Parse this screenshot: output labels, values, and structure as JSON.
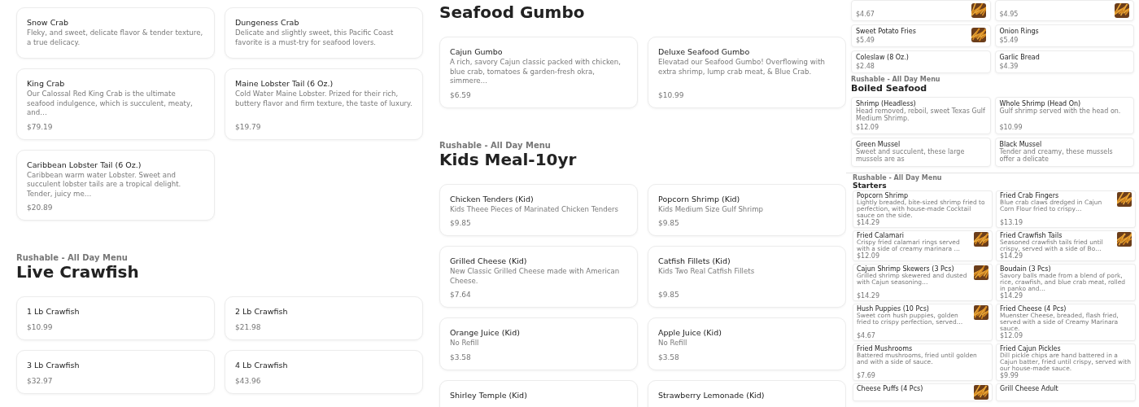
{
  "panels": [
    {
      "kind": "wide",
      "sections": [
        {
          "items": [
            {
              "name": "Snow Crab",
              "description": "Fleky, and sweet, delicate flavor & tender texture, a true delicacy."
            },
            {
              "name": "Dungeness Crab",
              "description": "Delicate and slightly sweet, this Pacific Coast favorite is a must-try for seafood lovers."
            },
            {
              "name": "King Crab",
              "description": "Our Calossal Red King Crab is the ultimate seafood indulgence, which is succulent, meaty, and…",
              "price": "$79.19"
            },
            {
              "name": "Maine Lobster Tail (6 Oz.)",
              "description": "Cold Water Maine Lobster. Prized for their rich, buttery flavor and firm texture, the taste of luxury.",
              "price": "$19.79"
            },
            {
              "name": "Caribbean Lobster Tail (6 Oz.)",
              "description": "Caribbean warm water Lobster. Sweet and succulent lobster tails are a tropical delight. Tender, juicy me…",
              "price": "$20.89"
            }
          ]
        },
        {
          "label": "Rushable - All Day Menu",
          "title": "Live Crawfish",
          "items": [
            {
              "name": "1 Lb Crawfish",
              "price": "$10.99"
            },
            {
              "name": "2 Lb Crawfish",
              "price": "$21.98"
            },
            {
              "name": "3 Lb Crawfish",
              "price": "$32.97"
            },
            {
              "name": "4 Lb Crawfish",
              "price": "$43.96"
            }
          ]
        }
      ]
    },
    {
      "kind": "wide",
      "sections": [
        {
          "title": "Seafood Gumbo",
          "items": [
            {
              "name": "Cajun Gumbo",
              "description": "A rich, savory Cajun classic packed with chicken, blue crab, tomatoes & garden-fresh okra, simmere…",
              "price": "$6.59"
            },
            {
              "name": "Deluxe Seafood Gumbo",
              "description": "Elevatad our Seafood Gumbo! Overflowing with extra shrimp, lump crab meat, & Blue Crab.",
              "price": "$10.99"
            }
          ]
        },
        {
          "label": "Rushable - All Day Menu",
          "title": "Kids Meal-10yr",
          "items": [
            {
              "name": "Chicken Tenders (Kid)",
              "description": "Kids Theee Pieces of Marinated Chicken Tenders",
              "price": "$9.85"
            },
            {
              "name": "Popcorn Shrimp (Kid)",
              "description": "Kids Medium Size Gulf Shrimp",
              "price": "$9.85"
            },
            {
              "name": "Grilled Cheese (Kid)",
              "description": "New Classic Grilled Cheese made with American Cheese.",
              "price": "$7.64"
            },
            {
              "name": "Catfish Fillets (Kid)",
              "description": "Kids Two Real Catfish Fillets",
              "price": "$9.85"
            },
            {
              "name": "Orange Juice (Kid)",
              "description": "No Refill",
              "price": "$3.58"
            },
            {
              "name": "Apple Juice (Kid)",
              "description": "No Refill",
              "price": "$3.58"
            },
            {
              "name": "Shirley Temple (Kid)"
            },
            {
              "name": "Strawberry Lemonade (Kid)"
            }
          ]
        }
      ]
    },
    {
      "kind": "compact",
      "sections": [
        {
          "items": [
            {
              "price": "$4.67"
            },
            {
              "price": "$4.95"
            },
            {
              "name": "Sweet Potato Fries",
              "price": "$5.49"
            },
            {
              "name": "Onion Rings",
              "price": "$5.49"
            },
            {
              "name": "Coleslaw (8 Oz.)",
              "price": "$2.48"
            },
            {
              "name": "Garlic Bread",
              "price": "$4.39"
            }
          ]
        },
        {
          "label": "Rushable - All Day Menu",
          "title": "Boiled Seafood",
          "items": [
            {
              "name": "Shrimp (Headless)",
              "description": "Head removed, reboil, sweet Texas Gulf Medium Shrimp.",
              "price": "$12.09"
            },
            {
              "name": "Whole Shrimp (Head On)",
              "description": "Gulf shrimp served with the head on.",
              "price": "$10.99"
            },
            {
              "name": "Green Mussel",
              "description": "Sweet and succulent, these large mussels are as"
            },
            {
              "name": "Black Mussel",
              "description": "Tender and creamy, these mussels offer a delicate"
            }
          ]
        }
      ]
    },
    {
      "kind": "mini",
      "sections": [
        {
          "label": "Rushable - All Day Menu",
          "title": "Starters",
          "items": [
            {
              "name": "Popcorn Shrimp",
              "description": "Lightly breaded, bite-sized shrimp fried to perfection, with house-made Cocktail sauce on the side.",
              "price": "$14.29"
            },
            {
              "name": "Fried Crab Fingers",
              "description": "Blue crab claws dredged in Cajun Corn Flour fried to crispy…",
              "price": "$13.19"
            },
            {
              "name": "Fried Calamari",
              "description": "Crispy fried calamari rings served with a side of creamy marinara …",
              "price": "$12.09"
            },
            {
              "name": "Fried Crawfish Tails",
              "description": "Seasoned crawfish tails fried until crispy, served with a side of Bo…",
              "price": "$14.29"
            },
            {
              "name": "Cajun Shrimp Skewers (3 Pcs)",
              "description": "Grilled shrimp skewered and dusted with Cajun seasoning…",
              "price": "$14.29"
            },
            {
              "name": "Boudain (3 Pcs)",
              "description": "Savory balls made from a blend of pork, rice, crawfish, and blue crab meat, rolled in panko and…",
              "price": "$14.29"
            },
            {
              "name": "Hush Puppies (10 Pcs)",
              "description": "Sweet corn hush puppies, golden fried to crispy perfection, served…",
              "price": "$4.67"
            },
            {
              "name": "Fried Cheese (4 Pcs)",
              "description": "Muenster Cheese, breaded, flash fried, served with a side of Creamy Marinara sauce.",
              "price": "$12.09"
            },
            {
              "name": "Fried Mushrooms",
              "description": "Battered mushrooms, fried until golden and with a side of sauce.",
              "price": "$7.69"
            },
            {
              "name": "Fried Cajun Pickles",
              "description": "Dill pickle chips are hand battered in a Cajun batter, fried until crispy, served with our house-made sauce.",
              "price": "$9.99"
            },
            {
              "name": "Cheese Puffs (4 Pcs)"
            },
            {
              "name": "Grill Cheese Adult"
            }
          ]
        }
      ]
    }
  ]
}
